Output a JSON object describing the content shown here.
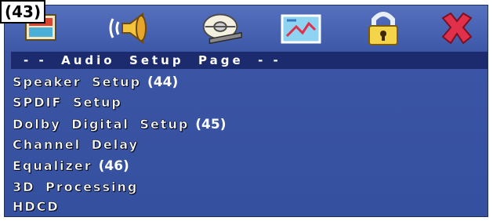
{
  "callouts": {
    "toolbar": "(43)",
    "speaker": "(44)",
    "dolby": "(45)",
    "equalizer": "(46)"
  },
  "toolbar": {
    "icons": [
      "general-setup-icon",
      "audio-setup-icon",
      "video-setup-icon",
      "preference-icon",
      "password-lock-icon",
      "exit-icon"
    ]
  },
  "page": {
    "title": "- -  Audio  Setup  Page  - -"
  },
  "menu": {
    "items": [
      {
        "label": "Speaker Setup",
        "callout": "(44)"
      },
      {
        "label": "SPDIF Setup"
      },
      {
        "label": "Dolby Digital Setup",
        "callout": "(45)"
      },
      {
        "label": "Channel Delay"
      },
      {
        "label": "Equalizer",
        "callout": "(46)"
      },
      {
        "label": "3D Processing"
      },
      {
        "label": "HDCD"
      }
    ]
  },
  "colors": {
    "background": "#3a54a3",
    "title_bar": "#1b2b6e",
    "text": "#ffffff",
    "exit": "#e0304a"
  }
}
